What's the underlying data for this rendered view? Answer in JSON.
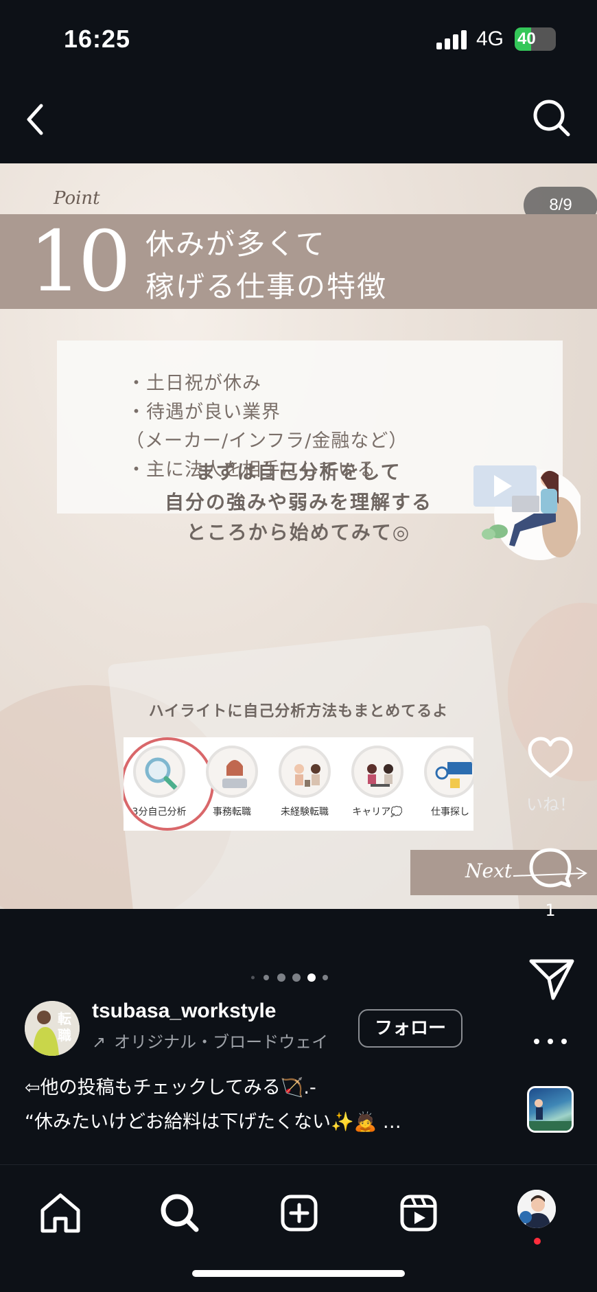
{
  "status_bar": {
    "time": "16:25",
    "network": "4G",
    "battery": "40",
    "battery_fraction": 0.4
  },
  "post": {
    "point_label": "Point",
    "point_number": "10",
    "page_counter": "8/9",
    "title_lines": [
      "休みが多くて",
      "稼げる仕事の特徴"
    ],
    "info_lines": [
      "・土日祝が休み",
      "・待遇が良い業界",
      "（メーカー/インフラ/金融など）",
      "・主に法人を相手にしている"
    ],
    "message_lines": [
      "まずは自己分析をして",
      "自分の強みや弱みを理解する",
      "ところから始めてみて◎"
    ],
    "highlight_note": "ハイライトに自己分析方法もまとめてるよ",
    "highlights": [
      "3分自己分析",
      "事務転職",
      "未経験転職",
      "キャリア💭",
      "仕事探し"
    ],
    "next_label": "Next"
  },
  "actions": {
    "like_label": "いね！",
    "comment_count": "1"
  },
  "author": {
    "username": "tsubasa_workstyle",
    "audio": "オリジナル・ブロードウェイ",
    "avatar_text": "転職",
    "follow_label": "フォロー"
  },
  "caption": {
    "line1": "⇦他の投稿もチェックしてみる🏹.-",
    "line2": "“休みたいけどお給料は下げたくない✨🙇 …"
  },
  "carousel": {
    "dot_count": 6,
    "active_index": 4
  },
  "icons": [
    "back-icon",
    "search-icon",
    "heart-icon",
    "comment-icon",
    "share-icon",
    "more-icon",
    "home-icon",
    "create-icon",
    "reels-icon"
  ],
  "colors": {
    "band": "#ab9a91",
    "background": "#0d1117",
    "ring": "#d9676a"
  }
}
